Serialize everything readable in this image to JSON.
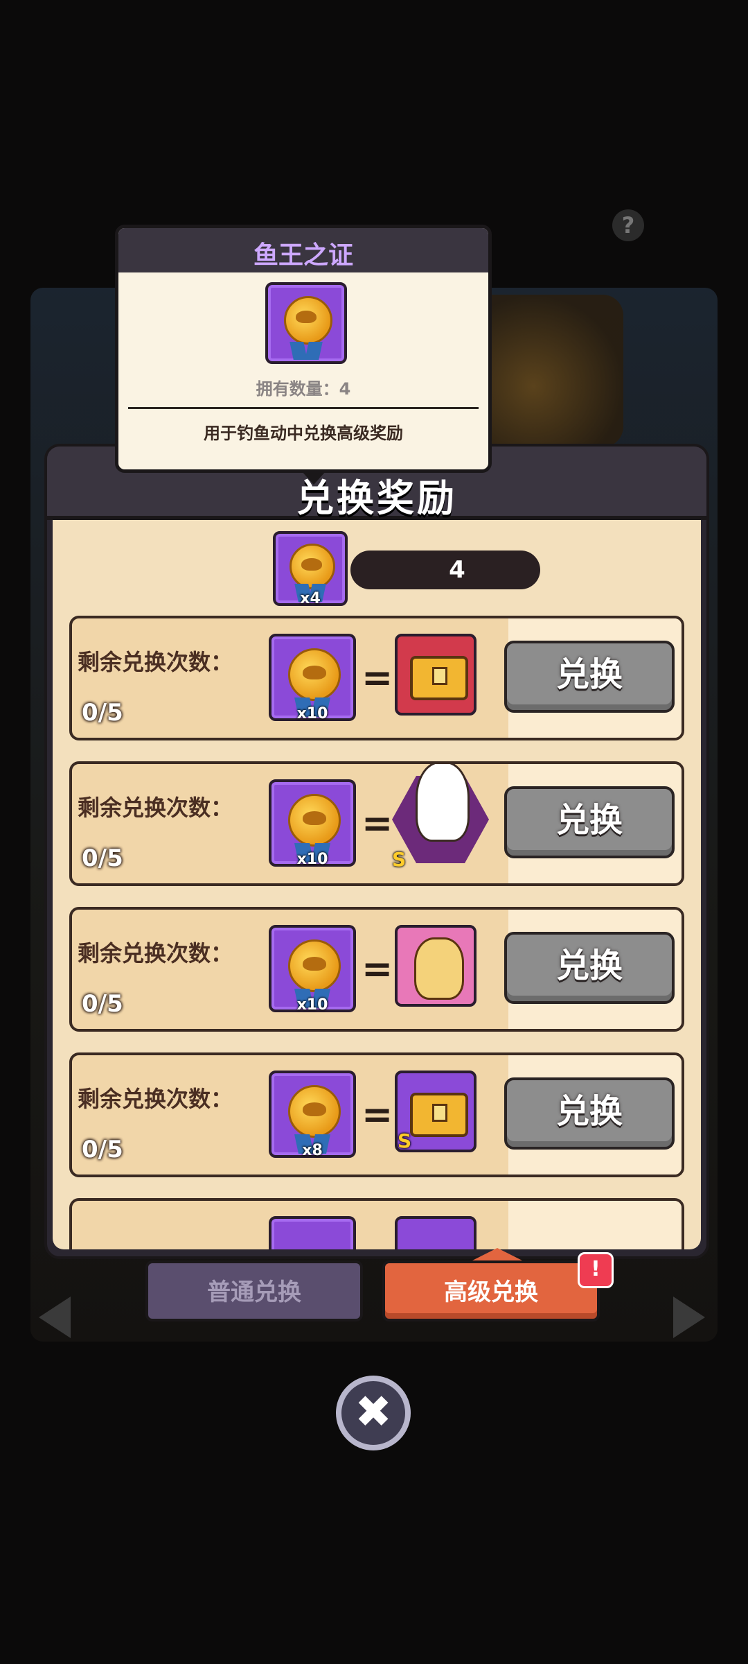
{
  "tooltip": {
    "title": "鱼王之证",
    "owned_label": "拥有数量：4",
    "description": "用于钓鱼动中兑换高级奖励"
  },
  "panel": {
    "title": "兑换奖励",
    "currency_amount": "4",
    "currency_multiplier": "x4"
  },
  "rows": [
    {
      "label": "剩余兑换次数：",
      "count": "0/5",
      "cost_multiplier": "x10",
      "reward": "red-treasure-chest",
      "button": "兑换"
    },
    {
      "label": "剩余兑换次数：",
      "count": "0/5",
      "cost_multiplier": "x10",
      "reward": "s-rank-character",
      "reward_rank": "S",
      "button": "兑换"
    },
    {
      "label": "剩余兑换次数：",
      "count": "0/5",
      "cost_multiplier": "x10",
      "reward": "pink-pet-card",
      "button": "兑换"
    },
    {
      "label": "剩余兑换次数：",
      "count": "0/5",
      "cost_multiplier": "x8",
      "reward": "purple-skull-chest",
      "reward_rank": "S",
      "button": "兑换"
    }
  ],
  "tabs": {
    "normal": "普通兑换",
    "advanced": "高级兑换",
    "alert": "!"
  },
  "close_symbol": "✖",
  "help_symbol": "?",
  "colors": {
    "panel_bg": "#f3e0bd",
    "medal_box": "#8b4ad8",
    "exchange_button": "#8d8d8d",
    "active_tab": "#e2653f",
    "inactive_tab": "#5a4e6e"
  }
}
